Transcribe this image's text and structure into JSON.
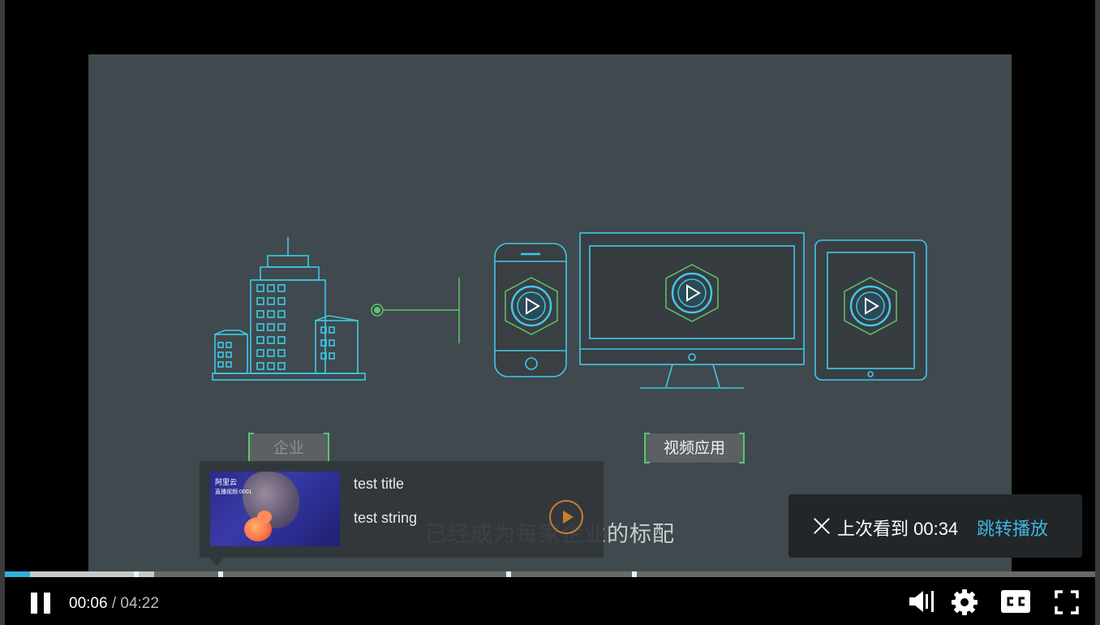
{
  "video": {
    "left_label": "企业",
    "right_label": "视频应用",
    "subtitle": "已经成为每家企业的标配"
  },
  "preview": {
    "title": "test title",
    "string": "test string",
    "thumb_logo": "阿里云",
    "thumb_sub": "直播视频:0001"
  },
  "resume": {
    "message": "上次看到 00:34",
    "jump_label": "跳转播放"
  },
  "progress": {
    "played_fraction": 0.023,
    "buffered_fraction": 0.137,
    "markers": [
      0.118,
      0.196,
      0.46,
      0.575
    ]
  },
  "controls": {
    "current_time": "00:06",
    "separator": " / ",
    "duration": "04:22"
  },
  "colors": {
    "accent": "#2fb0db",
    "jump_link": "#3fb5e0",
    "line_cyan": "#3ec9e8",
    "line_green": "#5fc46a",
    "center_play": "#c97e2c"
  },
  "icons": [
    "pause-icon",
    "volume-icon",
    "settings-gear-icon",
    "cc-icon",
    "fullscreen-icon",
    "close-icon",
    "play-icon"
  ]
}
